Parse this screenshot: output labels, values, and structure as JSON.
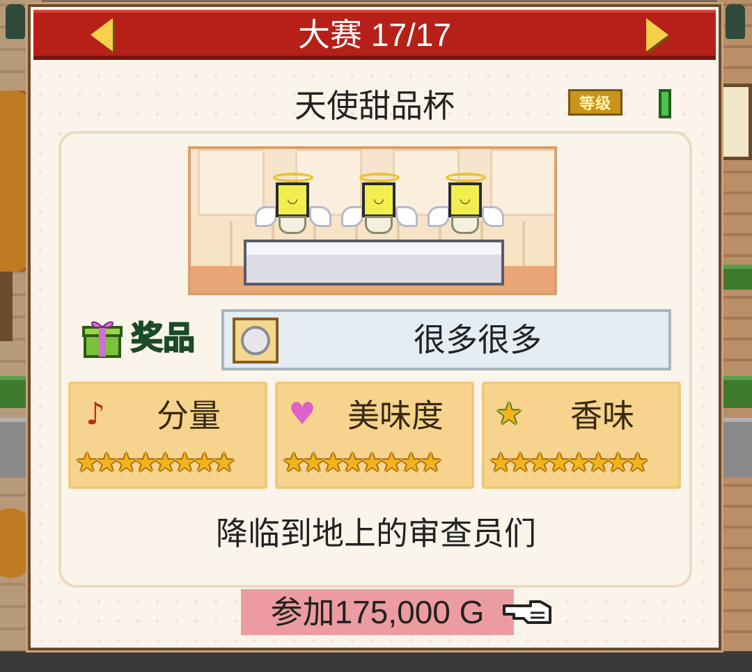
{
  "header": {
    "title": "大赛 17/17",
    "prev_icon": "left-triangle-arrow",
    "next_icon": "right-triangle-arrow"
  },
  "contest": {
    "name": "天使甜品杯",
    "level_badge": "等级",
    "level": 1
  },
  "prize": {
    "label": "奖品",
    "value": "很多很多",
    "icon": "gift-icon",
    "item_icon": "silver-coin-icon"
  },
  "stats": [
    {
      "label": "分量",
      "icon": "♪",
      "icon_name": "music-note-icon",
      "icon_color": "#c82418",
      "stars": 8
    },
    {
      "label": "美味度",
      "icon": "♥",
      "icon_name": "heart-icon",
      "icon_color": "#e060c8",
      "stars": 8
    },
    {
      "label": "香味",
      "icon": "★",
      "icon_name": "star-icon",
      "icon_color": "#f2b41e",
      "stars": 8
    }
  ],
  "description": "降临到地上的审查员们",
  "join": {
    "label": "参加175,000 G",
    "pointer_icon": "pointing-hand-icon"
  },
  "colors": {
    "header_red": "#b62018",
    "panel_bg": "#fbf4ea",
    "stat_card": "#f6d48e",
    "join_button": "#ec9ca0",
    "prize_text": "#2f8a48"
  }
}
